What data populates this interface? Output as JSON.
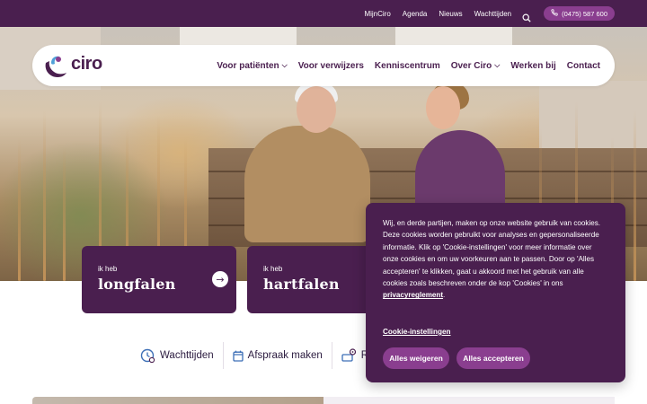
{
  "topbar": {
    "links": [
      "MijnCiro",
      "Agenda",
      "Nieuws",
      "Wachttijden"
    ],
    "phone": "(0475) 587 600",
    "search_icon": "search-icon",
    "phone_icon": "phone-icon"
  },
  "logo": {
    "text": "ciro"
  },
  "nav": {
    "items": [
      {
        "label": "Voor patiënten",
        "has_dropdown": true
      },
      {
        "label": "Voor verwijzers",
        "has_dropdown": false
      },
      {
        "label": "Kenniscentrum",
        "has_dropdown": false
      },
      {
        "label": "Over Ciro",
        "has_dropdown": true
      },
      {
        "label": "Werken bij",
        "has_dropdown": false
      },
      {
        "label": "Contact",
        "has_dropdown": false
      }
    ]
  },
  "cards": [
    {
      "pre": "ik heb",
      "title": "longfalen",
      "icon": "arrow-right-icon"
    },
    {
      "pre": "ik heb",
      "title": "hartfalen"
    }
  ],
  "quick_links": [
    {
      "label": "Wachttijden",
      "icon": "clock-person-icon"
    },
    {
      "label": "Afspraak maken",
      "icon": "calendar-icon"
    },
    {
      "label": "Ro",
      "icon": "route-icon"
    }
  ],
  "cookie": {
    "text": "Wij, en derde partijen, maken op onze website gebruik van cookies. Deze cookies worden gebruikt voor analyses en gepersonaliseerde informatie. Klik op 'Cookie-instellingen' voor meer informatie over onze cookies en om uw voorkeuren aan te passen. Door op 'Alles accepteren' te klikken, gaat u akkoord met het gebruik van alle cookies zoals beschreven onder de kop 'Cookies' in ons ",
    "privacy_link": "privacyreglement",
    "period": ".",
    "settings_link": "Cookie-instellingen",
    "reject_label": "Alles weigeren",
    "accept_label": "Alles accepteren"
  },
  "colors": {
    "brand_purple": "#4a1f4f",
    "accent_purple": "#8a3e8f",
    "logo_blue": "#4fa0d8"
  }
}
